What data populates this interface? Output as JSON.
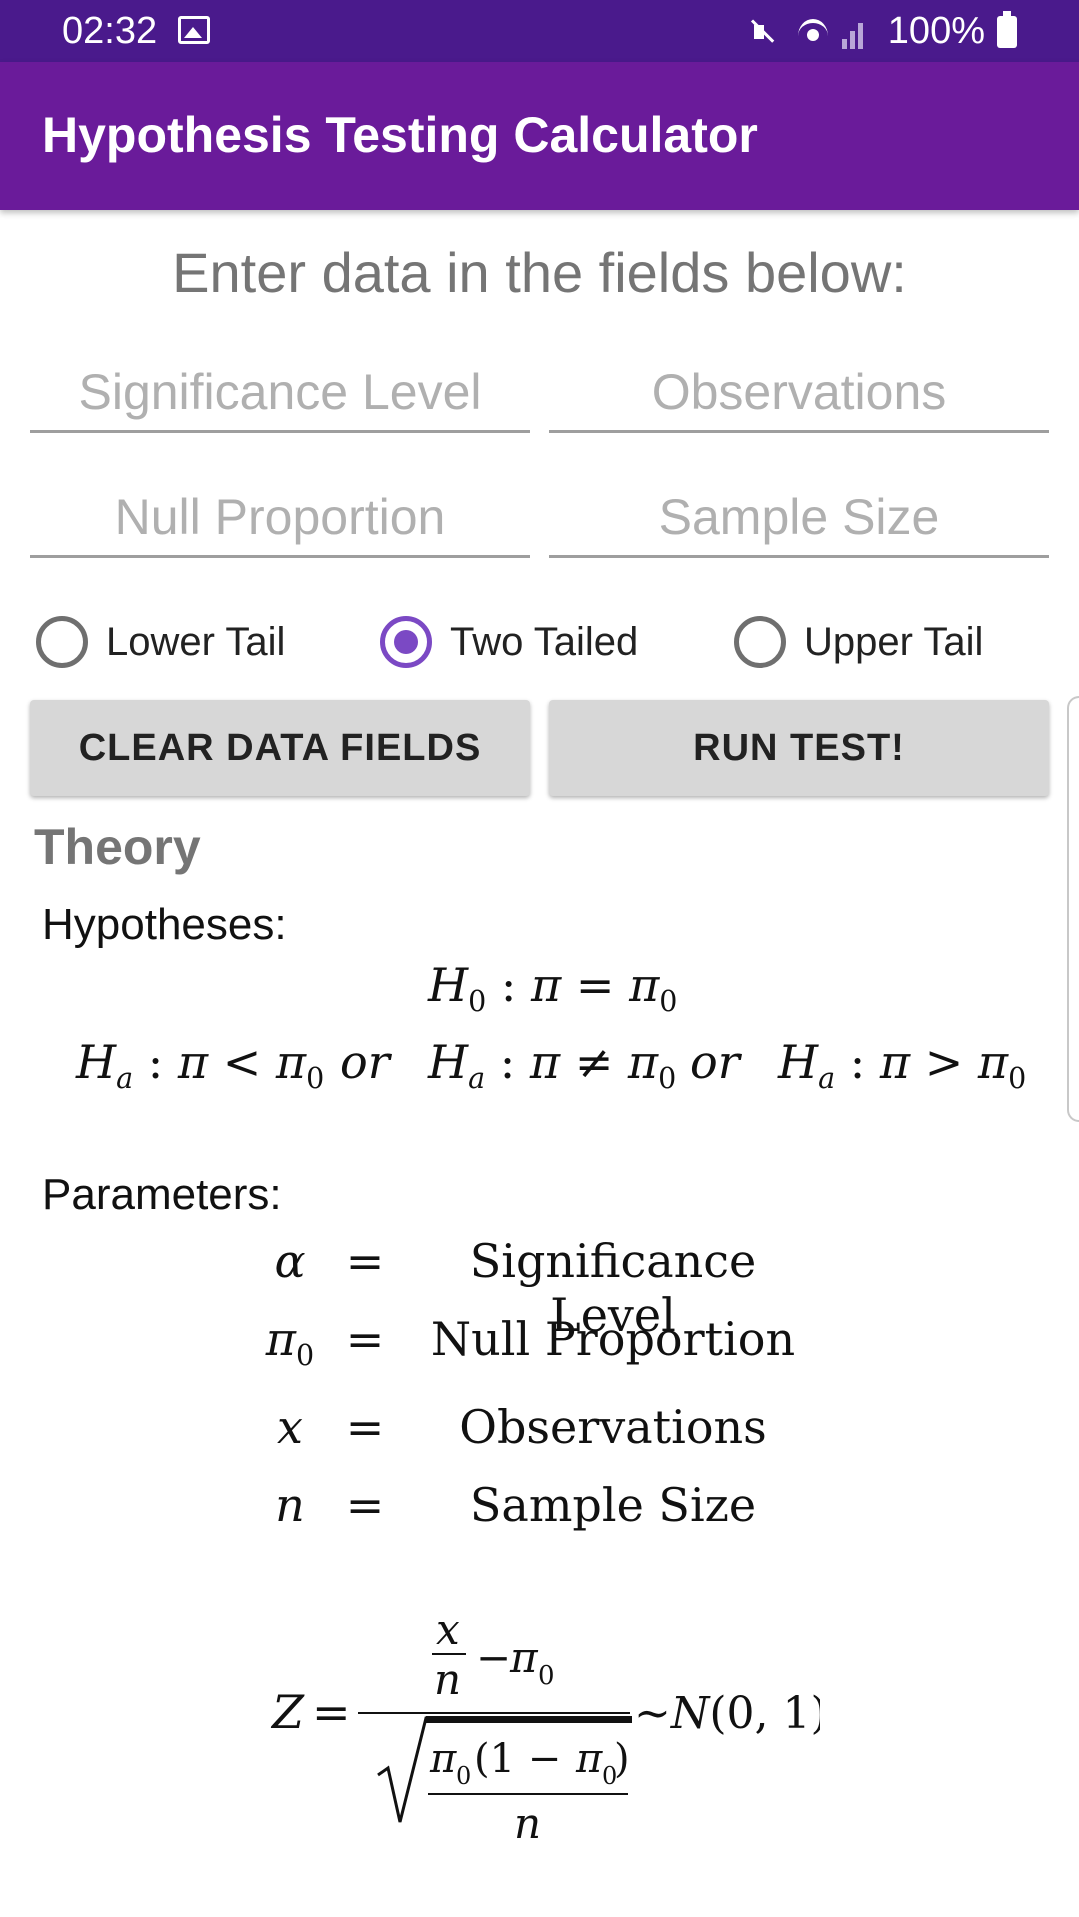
{
  "status_bar": {
    "time": "02:32",
    "battery": "100%",
    "icons": [
      "image-icon",
      "mute-icon",
      "wifi-icon",
      "signal-icon",
      "battery-icon"
    ]
  },
  "app_bar": {
    "title": "Hypothesis Testing Calculator"
  },
  "instruction": "Enter data in the fields below:",
  "fields": {
    "significance_placeholder": "Significance Level",
    "observations_placeholder": "Observations",
    "null_proportion_placeholder": "Null Proportion",
    "sample_size_placeholder": "Sample Size"
  },
  "radios": {
    "lower": "Lower Tail",
    "two": "Two Tailed",
    "upper": "Upper Tail",
    "selected": "Two Tailed"
  },
  "buttons": {
    "clear": "CLEAR DATA FIELDS",
    "run": "RUN TEST!"
  },
  "theory": {
    "heading": "Theory",
    "hypotheses_label": "Hypotheses:",
    "parameters_label": "Parameters:",
    "null_hypothesis": "H0 : π = π0",
    "alternatives": [
      "Ha : π < π0",
      "or",
      "Ha : π ≠ π0",
      "or",
      "Ha : π > π0"
    ],
    "parameters": [
      {
        "symbol": "α",
        "eq": "=",
        "desc": "Significance Level"
      },
      {
        "symbol": "π0",
        "eq": "=",
        "desc": "Null Proportion"
      },
      {
        "symbol": "x",
        "eq": "=",
        "desc": "Observations"
      },
      {
        "symbol": "n",
        "eq": "=",
        "desc": "Sample Size"
      }
    ],
    "formula": {
      "lhs": "Z =",
      "numerator": "x/n − π0",
      "denominator": "√(π0(1 − π0)/n)",
      "rhs": "~N(0, 1)"
    }
  },
  "colors": {
    "status_bar": "#4a1a8c",
    "app_bar": "#6a1b9a",
    "accent": "#7b49c4",
    "button_bg": "#d7d7d7"
  }
}
